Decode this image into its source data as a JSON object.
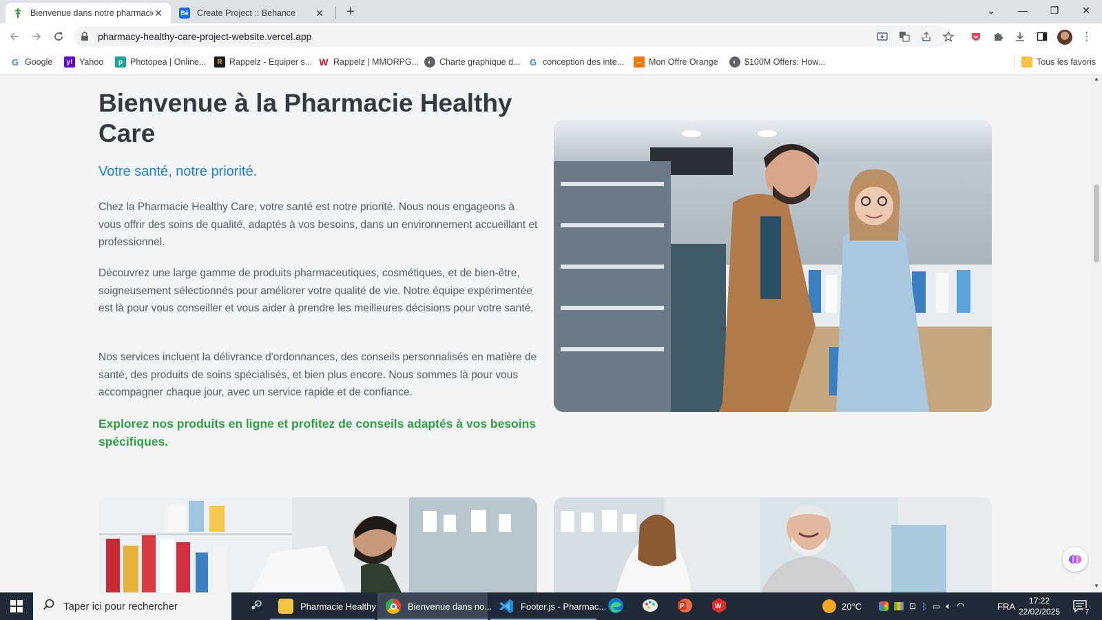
{
  "browser": {
    "tabs": [
      {
        "title": "Bienvenue dans notre pharmacie",
        "active": true
      },
      {
        "title": "Create Project :: Behance",
        "active": false
      }
    ],
    "url": "pharmacy-healthy-care-project-website.vercel.app",
    "bookmarks": [
      {
        "label": "Google",
        "icon": "google-icon"
      },
      {
        "label": "Yahoo",
        "icon": "yahoo-icon"
      },
      {
        "label": "Photopea | Online...",
        "icon": "photopea-icon"
      },
      {
        "label": "Rappelz - Equiper s...",
        "icon": "rappelz-icon"
      },
      {
        "label": "Rappelz | MMORPG...",
        "icon": "webzen-icon"
      },
      {
        "label": "Charte graphique d...",
        "icon": "globe-icon"
      },
      {
        "label": "conception des inte...",
        "icon": "google-icon"
      },
      {
        "label": "Mon Offre Orange",
        "icon": "orange-icon"
      },
      {
        "label": "$100M Offers: How...",
        "icon": "globe-icon"
      }
    ],
    "all_bookmarks": "Tous les favoris"
  },
  "page": {
    "title": "Bienvenue à la Pharmacie Healthy Care",
    "subtitle": "Votre santé, notre priorité.",
    "paragraphs": [
      "Chez la Pharmacie Healthy Care, votre santé est notre priorité. Nous nous engageons à vous offrir des soins de qualité, adaptés à vos besoins, dans un environnement accueillant et professionnel.",
      "Découvrez une large gamme de produits pharmaceutiques, cosmétiques, et de bien-être, soigneusement sélectionnés pour améliorer votre qualité de vie. Notre équipe expérimentée est là pour vous conseiller et vous aider à prendre les meilleures décisions pour votre santé.",
      "Nos services incluent la délivrance d'ordonnances, des conseils personnalisés en matière de santé, des produits de soins spécialisés, et bien plus encore. Nous sommes là pour vous accompagner chaque jour, avec un service rapide et de confiance."
    ],
    "cta": "Explorez nos produits en ligne et profitez de conseils adaptés à vos besoins spécifiques.",
    "colors": {
      "title": "#343a40",
      "subtitle": "#1f7ed0",
      "cta": "#2fa043",
      "background": "#f2f4f6"
    }
  },
  "taskbar": {
    "search_placeholder": "Taper ici pour rechercher",
    "apps": [
      {
        "label": "Pharmacie Healthy ...",
        "icon": "folder-icon"
      },
      {
        "label": "Bienvenue dans no...",
        "icon": "chrome-icon",
        "active": true
      },
      {
        "label": "Footer.js - Pharmac...",
        "icon": "vscode-icon"
      }
    ],
    "weather": "20°C",
    "language": "FRA",
    "time": "17:22",
    "date": "22/02/2025",
    "notifications": "7"
  }
}
